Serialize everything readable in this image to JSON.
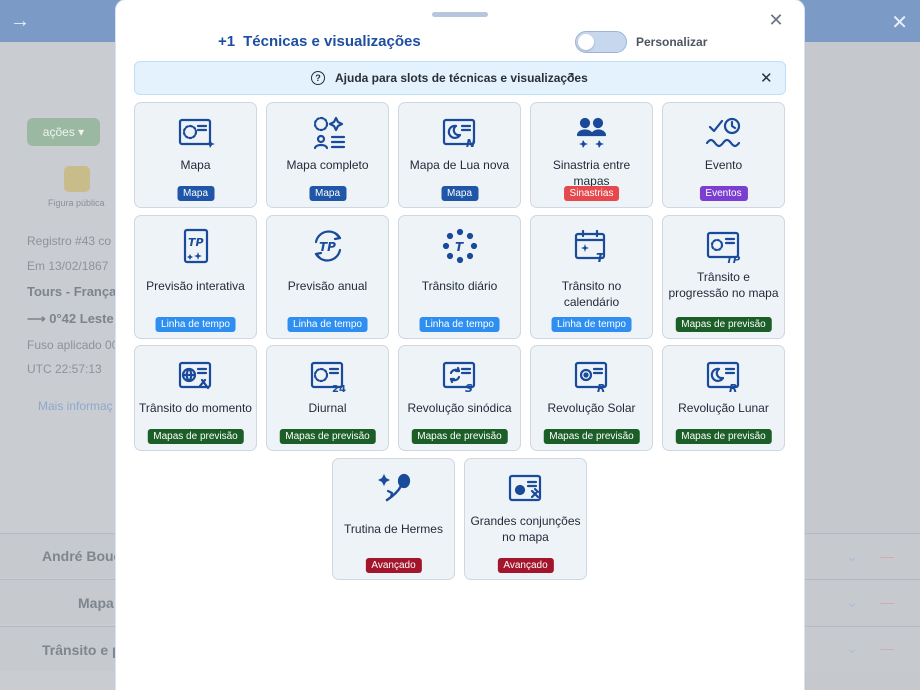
{
  "background": {
    "actions_button": "ações",
    "public_figure": "Figura pública",
    "register": "Registro #43 co",
    "date": "Em 13/02/1867",
    "place": "Tours - França",
    "longitude": "⟶  0°42 Leste",
    "timezone": "Fuso aplicado 00",
    "utc": "UTC 22:57:13",
    "more_info": "Mais informaç",
    "rows": [
      "André Bouc",
      "Mapa",
      "Trânsito e p"
    ]
  },
  "modal": {
    "title_count": "+1",
    "title": "Técnicas e visualizações",
    "customize_label": "Personalizar",
    "help_text": "Ajuda para slots de técnicas e visualizações",
    "help_ext": "↗"
  },
  "colors": {
    "mapa": "#1f56a8",
    "sinastrias": "#e5484d",
    "eventos": "#7a3fd0",
    "linha": "#2f8ff0",
    "previsao": "#1b5e28",
    "avancado": "#a3152b"
  },
  "cards": [
    {
      "name": "Mapa",
      "badge": "Mapa",
      "icon": "chart-wheel-icon"
    },
    {
      "name": "Mapa completo",
      "badge": "Mapa",
      "icon": "full-chart-icon"
    },
    {
      "name": "Mapa de Lua nova",
      "badge": "Mapa",
      "icon": "new-moon-chart-icon"
    },
    {
      "name": "Sinastria entre mapas",
      "badge": "Sinastrias",
      "icon": "synastry-icon"
    },
    {
      "name": "Evento",
      "badge": "Eventos",
      "icon": "event-clock-icon"
    },
    {
      "name": "Previsão interativa",
      "badge": "Linha de tempo",
      "icon": "interactive-forecast-icon"
    },
    {
      "name": "Previsão anual",
      "badge": "Linha de tempo",
      "icon": "annual-forecast-icon"
    },
    {
      "name": "Trânsito diário",
      "badge": "Linha de tempo",
      "icon": "daily-transit-icon"
    },
    {
      "name": "Trânsito no calendário",
      "badge": "Linha de tempo",
      "icon": "calendar-transit-icon"
    },
    {
      "name": "Trânsito e progressão no mapa",
      "badge": "Mapas de previsão",
      "icon": "transit-progression-icon"
    },
    {
      "name": "Trânsito do momento",
      "badge": "Mapas de previsão",
      "icon": "moment-transit-icon"
    },
    {
      "name": "Diurnal",
      "badge": "Mapas de previsão",
      "icon": "diurnal-icon"
    },
    {
      "name": "Revolução sinódica",
      "badge": "Mapas de previsão",
      "icon": "synodic-revolution-icon"
    },
    {
      "name": "Revolução Solar",
      "badge": "Mapas de previsão",
      "icon": "solar-revolution-icon"
    },
    {
      "name": "Revolução Lunar",
      "badge": "Mapas de previsão",
      "icon": "lunar-revolution-icon"
    },
    {
      "name": "Trutina de Hermes",
      "badge": "Avançado",
      "icon": "trutina-hermes-icon"
    },
    {
      "name": "Grandes conjunções no mapa",
      "badge": "Avançado",
      "icon": "great-conjunctions-icon"
    }
  ]
}
